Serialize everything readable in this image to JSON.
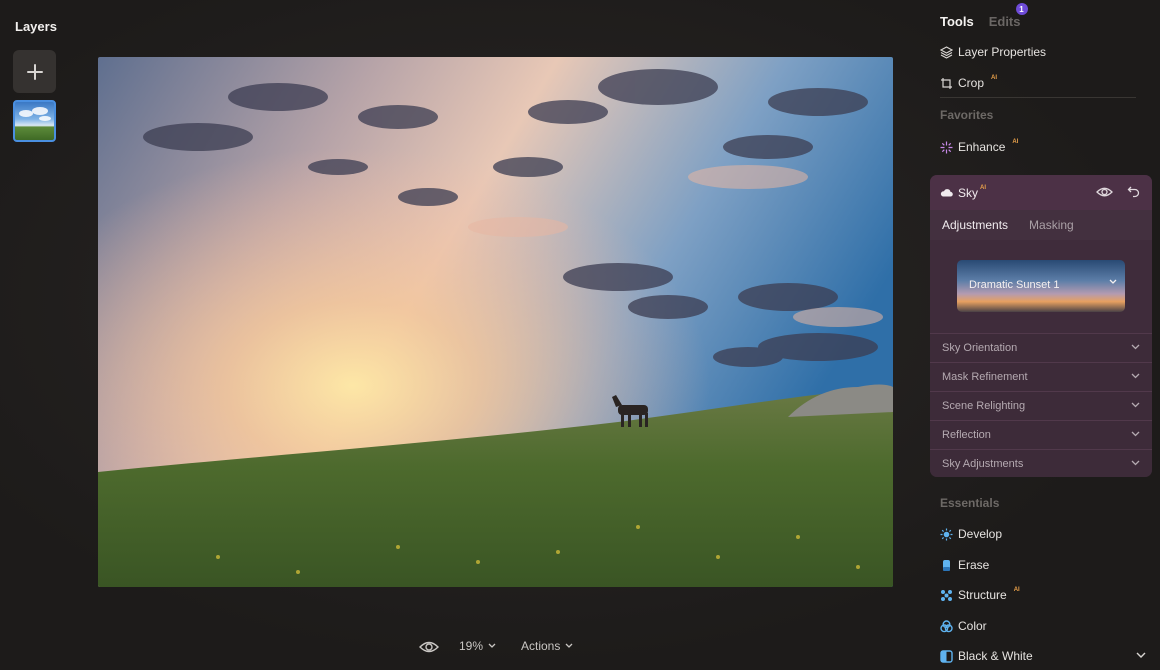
{
  "layers_panel": {
    "title": "Layers",
    "add_icon": "plus-icon"
  },
  "bottom_bar": {
    "eye_icon": "eye-icon",
    "zoom": "19%",
    "actions": "Actions"
  },
  "right_panel": {
    "tabs": {
      "tools": "Tools",
      "edits": "Edits",
      "edits_badge": "1"
    },
    "tools": [
      {
        "label": "Layer Properties",
        "icon": "layers-icon"
      },
      {
        "label": "Crop",
        "icon": "crop-icon",
        "ai": "AI"
      }
    ],
    "favorites_label": "Favorites",
    "favorites": [
      {
        "label": "Enhance",
        "icon": "sparkle-icon",
        "ai": "AI"
      }
    ],
    "sky": {
      "label": "Sky",
      "ai": "AI",
      "subtabs": [
        "Adjustments",
        "Masking"
      ],
      "preset": "Dramatic Sunset 1",
      "sections": [
        "Sky Orientation",
        "Mask Refinement",
        "Scene Relighting",
        "Reflection",
        "Sky Adjustments"
      ]
    },
    "essentials_label": "Essentials",
    "essentials": [
      {
        "label": "Develop",
        "icon": "sun-icon"
      },
      {
        "label": "Erase",
        "icon": "eraser-icon"
      },
      {
        "label": "Structure",
        "icon": "structure-icon",
        "ai": "AI"
      },
      {
        "label": "Color",
        "icon": "color-icon"
      },
      {
        "label": "Black & White",
        "icon": "bw-icon"
      }
    ]
  },
  "colors": {
    "accent_purple": "#6e4bd8",
    "sky_panel": "#3b2a37",
    "ai_tag": "#e8a04a",
    "layer_selected": "#4a8fe0"
  }
}
